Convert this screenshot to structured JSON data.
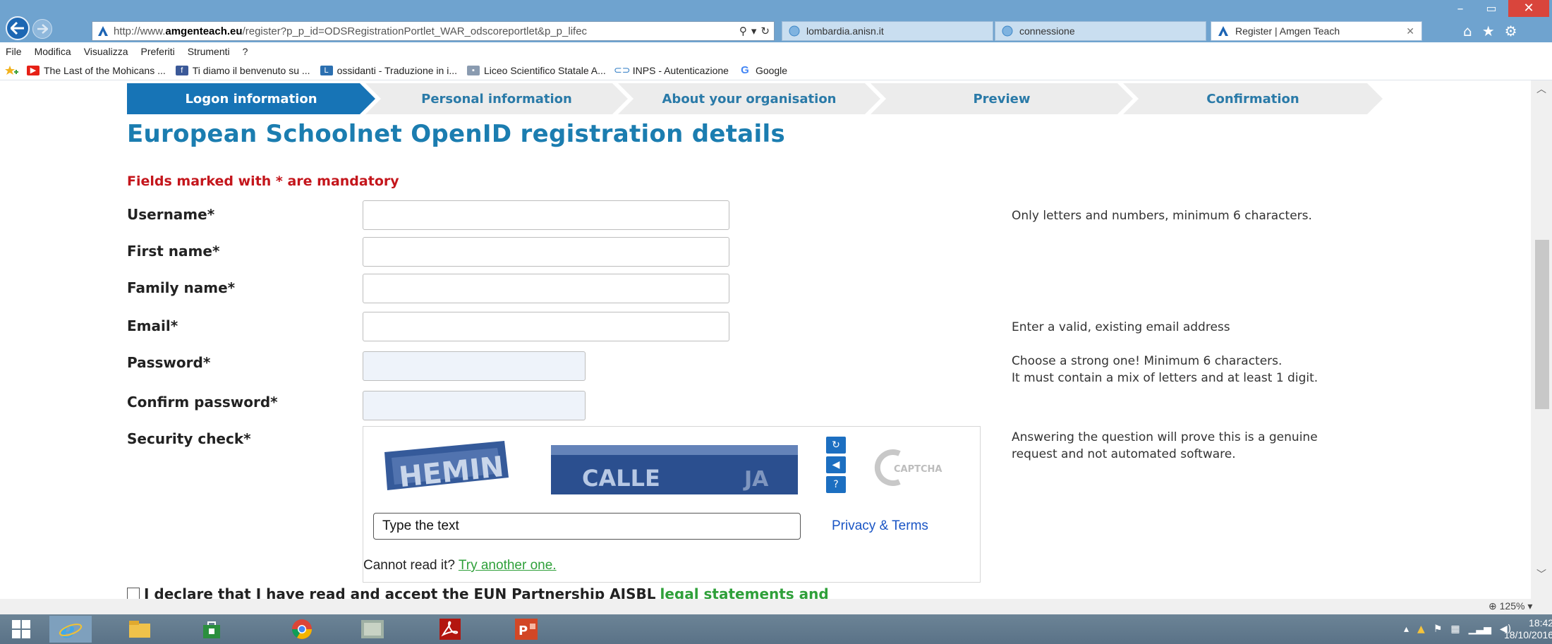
{
  "browser": {
    "address_prefix": "http://www.",
    "address_domain": "amgenteach.eu",
    "address_rest": "/register?p_p_id=ODSRegistrationPortlet_WAR_odscoreportlet&p_p_lifec",
    "search_glyph": "⚲",
    "dropdown_glyph": "▾",
    "refresh_glyph": "↻",
    "tabs": [
      {
        "label": "lombardia.anisn.it",
        "active": false
      },
      {
        "label": "connessione",
        "active": false
      },
      {
        "label": "Register | Amgen Teach",
        "active": true
      }
    ],
    "tab_close": "✕",
    "window_buttons": {
      "minimize": "–",
      "maximize": "▭",
      "close": "✕"
    },
    "chrome_icons": {
      "home": "⌂",
      "favorites": "★",
      "settings": "⚙"
    },
    "menu": [
      "File",
      "Modifica",
      "Visualizza",
      "Preferiti",
      "Strumenti",
      "?"
    ],
    "favorites": [
      {
        "label": "The Last of the Mohicans ...",
        "icon": "youtube-icon",
        "color": "#e62117"
      },
      {
        "label": "Ti diamo il benvenuto su ...",
        "icon": "facebook-icon",
        "color": "#3b5998"
      },
      {
        "label": "ossidanti - Traduzione in i...",
        "icon": "dictionary-icon",
        "color": "#2b6fb0"
      },
      {
        "label": "Liceo Scientifico Statale A...",
        "icon": "school-icon",
        "color": "#8a9bb0"
      },
      {
        "label": "INPS - Autenticazione",
        "icon": "inps-icon",
        "color": "#2e7bc4"
      },
      {
        "label": "Google",
        "icon": "google-icon",
        "color": "#4285f4"
      }
    ],
    "zoom": "125%",
    "zoom_dropdown": "▾"
  },
  "steps": [
    {
      "label": "Logon information",
      "active": true
    },
    {
      "label": "Personal information",
      "active": false
    },
    {
      "label": "About your organisation",
      "active": false
    },
    {
      "label": "Preview",
      "active": false
    },
    {
      "label": "Confirmation",
      "active": false
    }
  ],
  "form": {
    "title": "European Schoolnet OpenID registration details",
    "mandatory_note": "Fields marked with * are mandatory",
    "fields": {
      "username": {
        "label": "Username*",
        "value": "",
        "hint": "Only letters and numbers, minimum 6 characters."
      },
      "first_name": {
        "label": "First name*",
        "value": ""
      },
      "family_name": {
        "label": "Family name*",
        "value": ""
      },
      "email": {
        "label": "Email*",
        "value": "",
        "hint": "Enter a valid, existing email address"
      },
      "password": {
        "label": "Password*",
        "value": "",
        "hint_line1": "Choose a strong one! Minimum 6 characters.",
        "hint_line2": "It must contain a mix of letters and at least 1 digit."
      },
      "confirm_password": {
        "label": "Confirm password*",
        "value": ""
      }
    },
    "security": {
      "label": "Security check*",
      "hint_line1": "Answering the question will prove this is a genuine",
      "hint_line2": "request and not automated software.",
      "captcha_word1": "HEMIN",
      "captcha_word2": "CALLE",
      "captcha_word3": "JA",
      "logo_text": "CAPTCHA",
      "input_placeholder": "Type the text",
      "privacy_link": "Privacy & Terms",
      "cannot_read": "Cannot read it?",
      "try_another": "Try another one."
    },
    "declare_text": "I declare that I have read and accept the EUN Partnership AISBL",
    "declare_link": "legal statements and"
  },
  "taskbar": {
    "time": "18:42",
    "date": "18/10/2016"
  }
}
